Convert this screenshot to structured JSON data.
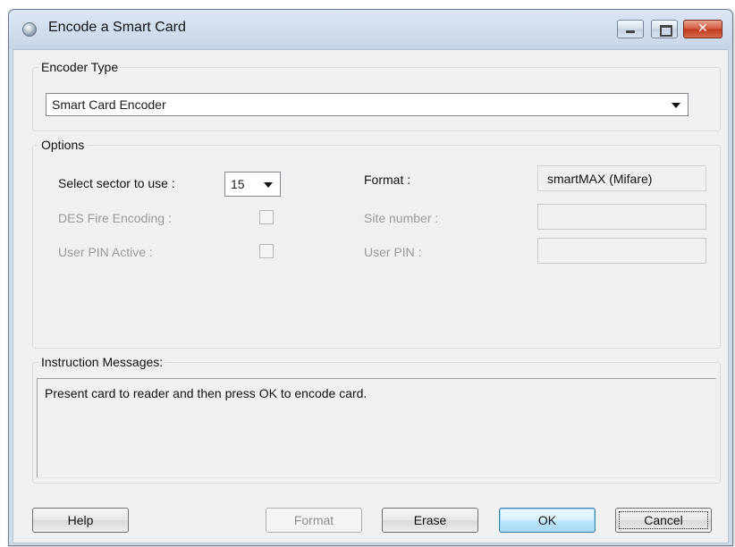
{
  "window": {
    "title": "Encode a Smart Card",
    "icon": "smart-card-app-icon"
  },
  "encoder_type": {
    "group_label": "Encoder Type",
    "selected": "Smart Card Encoder"
  },
  "options": {
    "group_label": "Options",
    "sector_label": "Select sector to use :",
    "sector_value": "15",
    "format_label": "Format :",
    "format_value": "smartMAX (Mifare)",
    "des_label": "DES Fire Encoding :",
    "site_number_label": "Site number :",
    "site_number_value": "",
    "pin_active_label": "User PIN Active :",
    "user_pin_label": "User PIN :",
    "user_pin_value": ""
  },
  "instructions": {
    "group_label": "Instruction Messages:",
    "message": "Present card to reader and then press OK to encode card."
  },
  "buttons": {
    "help": "Help",
    "format": "Format",
    "erase": "Erase",
    "ok": "OK",
    "cancel": "Cancel"
  }
}
